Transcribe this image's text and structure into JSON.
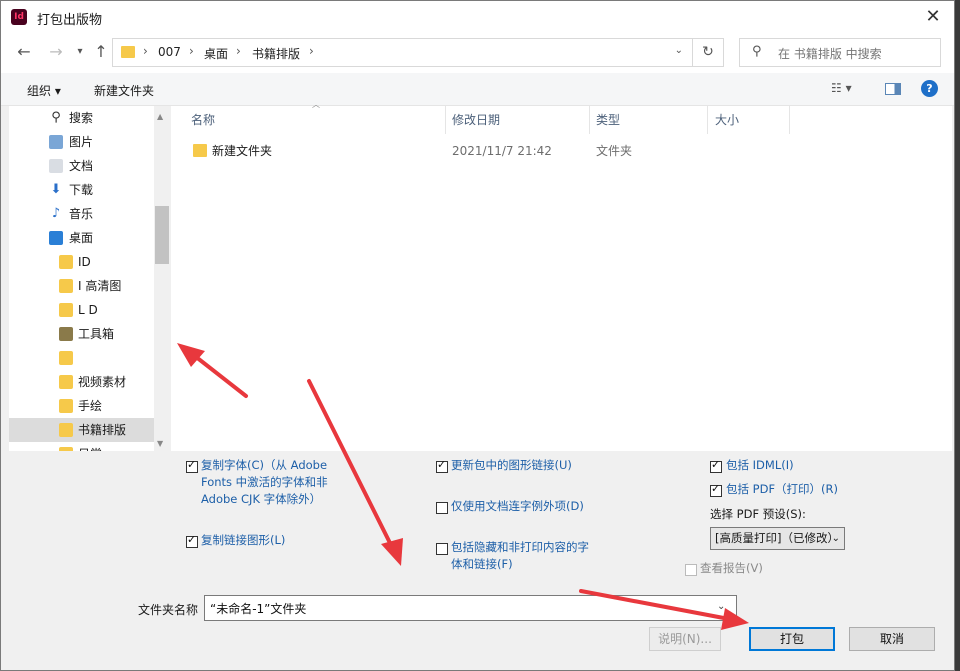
{
  "window": {
    "title": "打包出版物",
    "app_icon": "Id"
  },
  "nav": {
    "breadcrumb": [
      "007",
      "桌面",
      "书籍排版"
    ],
    "search_placeholder": "在 书籍排版 中搜索"
  },
  "toolbar": {
    "organize_label": "组织 ▾",
    "new_folder_label": "新建文件夹",
    "view_label": "☷ ▾",
    "help_label": "?"
  },
  "sidebar": {
    "items": [
      {
        "label": "搜索",
        "icon": "search-icon"
      },
      {
        "label": "图片",
        "icon": "pictures-icon"
      },
      {
        "label": "文档",
        "icon": "documents-icon"
      },
      {
        "label": "下载",
        "icon": "download-icon"
      },
      {
        "label": "音乐",
        "icon": "music-icon"
      },
      {
        "label": "桌面",
        "icon": "desktop-icon"
      },
      {
        "label": "ID",
        "icon": "folder-icon"
      },
      {
        "label": "I  高清图",
        "icon": "folder-icon"
      },
      {
        "label": "L  D",
        "icon": "folder-icon"
      },
      {
        "label": "工具箱",
        "icon": "toolbox-icon"
      },
      {
        "label": "",
        "icon": "folder-icon"
      },
      {
        "label": "视频素材",
        "icon": "folder-icon"
      },
      {
        "label": "手绘",
        "icon": "folder-icon"
      },
      {
        "label": "书籍排版",
        "icon": "folder-icon"
      },
      {
        "label": "日常",
        "icon": "folder-icon"
      }
    ],
    "selected_index": 13
  },
  "filelist": {
    "columns": [
      "名称",
      "修改日期",
      "类型",
      "大小"
    ],
    "rows": [
      {
        "name": "新建文件夹",
        "modified": "2021/11/7 21:42",
        "type": "文件夹",
        "size": ""
      }
    ]
  },
  "options": {
    "copy_fonts": {
      "label_lines": [
        "复制字体(C)（从 Adobe",
        "Fonts 中激活的字体和非",
        "Adobe CJK 字体除外）"
      ],
      "checked": true
    },
    "copy_links": {
      "label": "复制链接图形(L)",
      "checked": true
    },
    "update_links": {
      "label": "更新包中的图形链接(U)",
      "checked": true
    },
    "doc_hyphenation": {
      "label": "仅使用文档连字例外项(D)",
      "checked": false
    },
    "include_hidden": {
      "label_lines": [
        "包括隐藏和非打印内容的字",
        "体和链接(F)"
      ],
      "checked": false
    },
    "include_idml": {
      "label": "包括 IDML(I)",
      "checked": true
    },
    "include_pdf": {
      "label": "包括 PDF（打印）(R)",
      "checked": true
    },
    "pdf_preset_label": "选择 PDF 预设(S):",
    "pdf_preset_value": "[高质量打印]（已修改）",
    "view_report": {
      "label": "查看报告(V)",
      "checked": false,
      "enabled": false
    }
  },
  "footer": {
    "folder_name_label": "文件夹名称",
    "folder_name_value": "“未命名-1”文件夹",
    "instructions_button": "说明(N)...",
    "package_button": "打包",
    "cancel_button": "取消"
  },
  "colors": {
    "accent": "#0078d7",
    "option_text": "#1d5fa8",
    "annotation_arrow": "#e8383d",
    "folder": "#f6c94a"
  }
}
